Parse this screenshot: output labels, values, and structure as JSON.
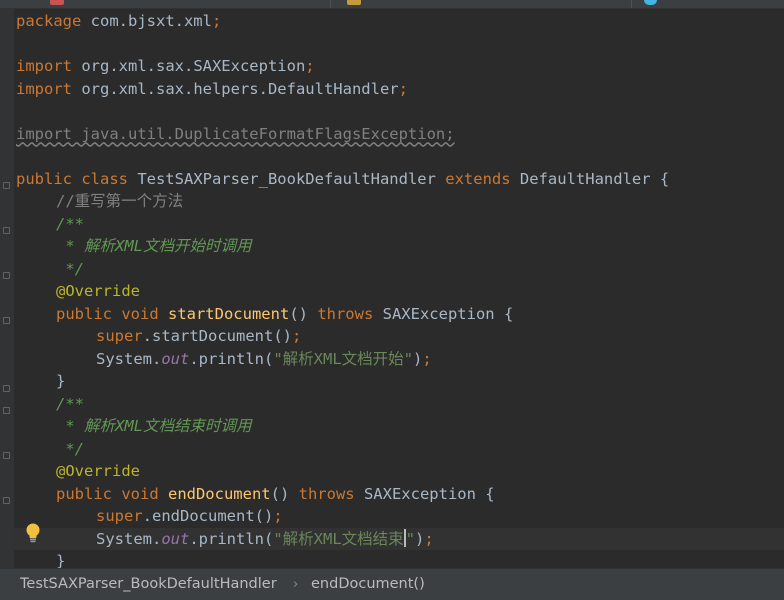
{
  "colors": {
    "background": "#2b2b2b",
    "keyword": "#cc7832",
    "method": "#ffc66d",
    "string": "#6a8759",
    "doc_comment": "#629755",
    "annotation": "#bbb529",
    "static_field": "#9876aa",
    "default_text": "#a9b7c6"
  },
  "editor": {
    "lines": [
      {
        "indent": 0,
        "tokens": [
          {
            "t": "package",
            "c": "kw"
          },
          {
            "t": " com.bjsxt.xml",
            "c": ""
          },
          {
            "t": ";",
            "c": "kw"
          }
        ]
      },
      {
        "indent": 0,
        "tokens": []
      },
      {
        "indent": 0,
        "tokens": [
          {
            "t": "import",
            "c": "kw"
          },
          {
            "t": " org.xml.sax.SAXException",
            "c": ""
          },
          {
            "t": ";",
            "c": "kw"
          }
        ]
      },
      {
        "indent": 0,
        "tokens": [
          {
            "t": "import",
            "c": "kw"
          },
          {
            "t": " org.xml.sax.helpers.DefaultHandler",
            "c": ""
          },
          {
            "t": ";",
            "c": "kw"
          }
        ]
      },
      {
        "indent": 0,
        "tokens": []
      },
      {
        "indent": 0,
        "tokens": [
          {
            "t": "import java.util.DuplicateFormatFlagsException;",
            "c": "unused"
          }
        ]
      },
      {
        "indent": 0,
        "tokens": []
      },
      {
        "indent": 0,
        "tokens": [
          {
            "t": "public class",
            "c": "kw"
          },
          {
            "t": " TestSAXParser_BookDefaultHandler ",
            "c": ""
          },
          {
            "t": "extends",
            "c": "kw"
          },
          {
            "t": " DefaultHandler {",
            "c": ""
          }
        ]
      },
      {
        "indent": 1,
        "tokens": [
          {
            "t": "//重写第一个方法",
            "c": "cmt"
          }
        ]
      },
      {
        "indent": 1,
        "tokens": [
          {
            "t": "/**",
            "c": "doc"
          }
        ]
      },
      {
        "indent": 1,
        "tokens": [
          {
            "t": " * 解析XML文档开始时调用",
            "c": "doc"
          }
        ]
      },
      {
        "indent": 1,
        "tokens": [
          {
            "t": " */",
            "c": "doc"
          }
        ]
      },
      {
        "indent": 1,
        "tokens": [
          {
            "t": "@Override",
            "c": "ann"
          }
        ]
      },
      {
        "indent": 1,
        "tokens": [
          {
            "t": "public void ",
            "c": "kw"
          },
          {
            "t": "startDocument",
            "c": "fn"
          },
          {
            "t": "() ",
            "c": ""
          },
          {
            "t": "throws",
            "c": "kw"
          },
          {
            "t": " SAXException {",
            "c": ""
          }
        ]
      },
      {
        "indent": 2,
        "tokens": [
          {
            "t": "super",
            "c": "kw"
          },
          {
            "t": ".startDocument()",
            "c": ""
          },
          {
            "t": ";",
            "c": "kw"
          }
        ]
      },
      {
        "indent": 2,
        "tokens": [
          {
            "t": "System.",
            "c": ""
          },
          {
            "t": "out",
            "c": "field"
          },
          {
            "t": ".println(",
            "c": ""
          },
          {
            "t": "\"解析XML文档开始\"",
            "c": "str"
          },
          {
            "t": ")",
            "c": ""
          },
          {
            "t": ";",
            "c": "kw"
          }
        ]
      },
      {
        "indent": 1,
        "tokens": [
          {
            "t": "}",
            "c": ""
          }
        ]
      },
      {
        "indent": 1,
        "tokens": [
          {
            "t": "/**",
            "c": "doc"
          }
        ]
      },
      {
        "indent": 1,
        "tokens": [
          {
            "t": " * 解析XML文档结束时调用",
            "c": "doc"
          }
        ]
      },
      {
        "indent": 1,
        "tokens": [
          {
            "t": " */",
            "c": "doc"
          }
        ]
      },
      {
        "indent": 1,
        "tokens": [
          {
            "t": "@Override",
            "c": "ann"
          }
        ]
      },
      {
        "indent": 1,
        "tokens": [
          {
            "t": "public void ",
            "c": "kw"
          },
          {
            "t": "endDocument",
            "c": "fn"
          },
          {
            "t": "() ",
            "c": ""
          },
          {
            "t": "throws",
            "c": "kw"
          },
          {
            "t": " SAXException {",
            "c": ""
          }
        ]
      },
      {
        "indent": 2,
        "tokens": [
          {
            "t": "super",
            "c": "kw"
          },
          {
            "t": ".endDocument()",
            "c": ""
          },
          {
            "t": ";",
            "c": "kw"
          }
        ]
      },
      {
        "indent": 2,
        "current": true,
        "tokens": [
          {
            "t": "System.",
            "c": ""
          },
          {
            "t": "out",
            "c": "field"
          },
          {
            "t": ".println(",
            "c": ""
          },
          {
            "t": "\"解析XML文档结束",
            "c": "str"
          },
          {
            "t": "|",
            "c": "caret"
          },
          {
            "t": "\"",
            "c": "str"
          },
          {
            "t": ")",
            "c": ""
          },
          {
            "t": ";",
            "c": "kw"
          }
        ]
      },
      {
        "indent": 1,
        "tokens": [
          {
            "t": "}",
            "c": ""
          }
        ]
      }
    ]
  },
  "gutter": {
    "intention_icon": "lightbulb-icon",
    "fold_marker_icon": "fold-marker-icon"
  },
  "breadcrumb": {
    "class_name": "TestSAXParser_BookDefaultHandler",
    "separator": "›",
    "method_name": "endDocument()"
  }
}
